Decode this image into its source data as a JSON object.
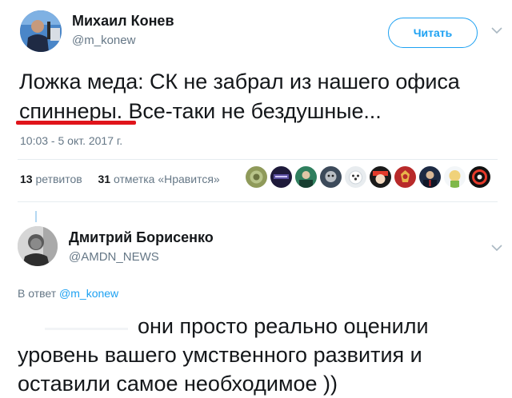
{
  "tweet": {
    "author_name": "Михаил Конев",
    "author_handle": "@m_konew",
    "follow_label": "Читать",
    "text": "Ложка меда: СК не забрал из нашего офиса спиннеры. Все-таки не бездушные...",
    "timestamp": "10:03 - 5 окт. 2017 г.",
    "retweets_count": "13",
    "retweets_label": "ретвитов",
    "likes_count": "31",
    "likes_label": "отметка «Нравится»",
    "underline_color": "#e0141b"
  },
  "reply": {
    "author_name": "Дмитрий Борисенко",
    "author_handle": "@AMDN_NEWS",
    "reply_prefix": "В ответ",
    "reply_to_handle": "@m_konew",
    "text": "они просто реально оценили уровень вашего умственного развития и оставили самое необходимое ))"
  },
  "colors": {
    "accent": "#1da1f2",
    "secondary_text": "#657786",
    "primary_text": "#14171a"
  }
}
